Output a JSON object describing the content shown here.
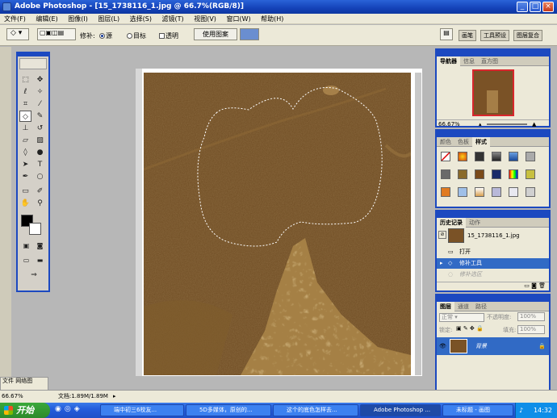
{
  "window": {
    "title": "Adobe Photoshop - [15_1738116_1.jpg @ 66.7%(RGB/8)]"
  },
  "menu": [
    "文件(F)",
    "编辑(E)",
    "图像(I)",
    "图层(L)",
    "选择(S)",
    "滤镜(T)",
    "视图(V)",
    "窗口(W)",
    "帮助(H)"
  ],
  "options": {
    "patch_label": "修补:",
    "source_label": "源",
    "target_label": "目标",
    "transparent_label": "透明",
    "use_pattern_label": "使用图案",
    "palette_tabs": [
      "画笔",
      "工具预设",
      "图层复合"
    ]
  },
  "navigator": {
    "tabs": [
      "导航器",
      "信息",
      "直方图"
    ],
    "zoom": "66.67%"
  },
  "styles_panel": {
    "tabs": [
      "颜色",
      "色板",
      "样式"
    ]
  },
  "history": {
    "tabs": [
      "历史记录",
      "动作"
    ],
    "snapshot": "15_1738116_1.jpg",
    "items": [
      "打开",
      "修补工具",
      "修补选区"
    ]
  },
  "layers": {
    "tabs": [
      "图层",
      "通道",
      "路径"
    ],
    "blend_mode": "正常",
    "opacity_label": "不透明度:",
    "opacity": "100%",
    "lock_label": "锁定:",
    "fill_label": "填充:",
    "fill": "100%",
    "layer_name": "背景"
  },
  "left_dock": {
    "tabs": [
      "文件",
      "网络图"
    ]
  },
  "status": {
    "zoom": "66.67%",
    "doc": "文档:1.89M/1.89M"
  },
  "taskbar": {
    "start": "开始",
    "buttons": [
      "端中初三6校友...",
      "5D多媒体，原创的...",
      "这个的底色怎样去...",
      "Adobe Photoshop ...",
      "未标题 - 画图"
    ],
    "time": "14:32"
  },
  "colors": {
    "selection": "#1c49c0",
    "highlight": "#316ac5"
  }
}
